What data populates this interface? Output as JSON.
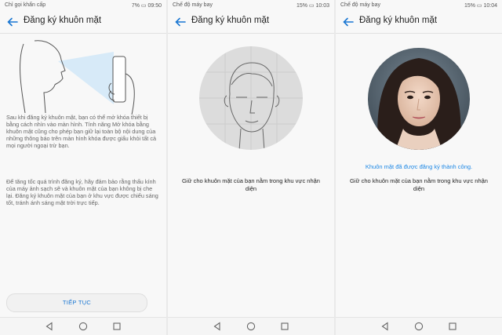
{
  "screens": [
    {
      "status": {
        "left": "Chỉ gọi khẩn cấp",
        "right": "7% ▭ 09:50"
      },
      "title": "Đăng ký khuôn mặt",
      "paragraphs": [
        "Sau khi đăng ký khuôn mặt, bạn có thể mở khóa thiết bị bằng cách nhìn vào màn hình. Tính năng Mở khóa bằng khuôn mặt cũng cho phép bạn giữ lại toàn bộ nội dung của những thông báo trên màn hình khóa được giấu khỏi tất cả mọi người ngoại trừ bạn.",
        "Để tăng tốc quá trình đăng ký, hãy đảm bảo rằng thấu kính của máy ảnh sạch sẽ và khuôn mặt của bạn không bị che lại. Đăng ký khuôn mặt của bạn ở khu vực được chiếu sáng tốt, tránh ánh sáng mặt trời trực tiếp."
      ],
      "button": "TIẾP TỤC"
    },
    {
      "status": {
        "left": "Chế độ máy bay",
        "right": "15% ▭ 10:03"
      },
      "title": "Đăng ký khuôn mặt",
      "hint": "Giữ cho khuôn mặt của bạn nằm trong khu vực nhận diện"
    },
    {
      "status": {
        "left": "Chế độ máy bay",
        "right": "15% ▭ 10:04"
      },
      "title": "Đăng ký khuôn mặt",
      "success": "Khuôn mặt đã được đăng ký thành công.",
      "hint": "Giữ cho khuôn mặt của bạn nằm trong khu vực nhận diện"
    }
  ],
  "colors": {
    "accent": "#1e88e5",
    "text": "#222222",
    "muted": "#666666"
  },
  "icons": [
    "back-arrow-icon",
    "nav-back-icon",
    "nav-home-icon",
    "nav-recents-icon"
  ]
}
